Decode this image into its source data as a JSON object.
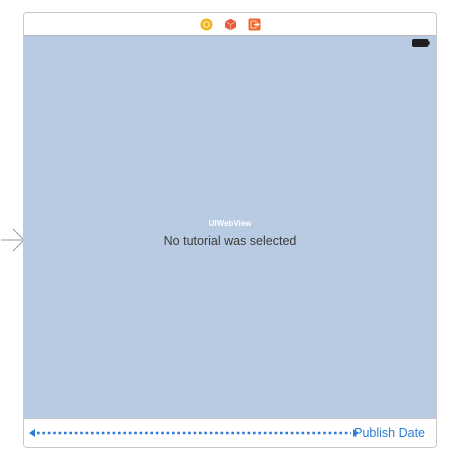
{
  "scene": {
    "dock_icons": [
      "view-controller-icon",
      "first-responder-icon",
      "exit-icon"
    ],
    "status_bar": {
      "battery": "battery-icon"
    }
  },
  "web_view": {
    "class_label": "UIWebView",
    "message": "No tutorial was selected",
    "background": "#b8cbe3"
  },
  "toolbar": {
    "flexible_space": "flexible-space-arrow",
    "bar_button_label": "Publish Date",
    "tint": "#2c7bd6"
  },
  "colors": {
    "view_controller": "#f2b21b",
    "first_responder": "#e85a3a",
    "exit": "#ec6a2f",
    "border": "#c8c8c8"
  }
}
